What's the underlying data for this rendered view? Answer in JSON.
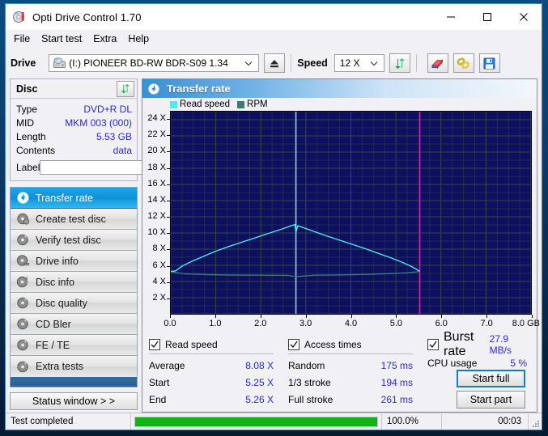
{
  "window": {
    "title": "Opti Drive Control 1.70",
    "icon": "disc-icon",
    "minimize": "minimize-icon",
    "maximize": "maximize-icon",
    "close": "close-icon"
  },
  "menu": {
    "items": [
      {
        "label": "File"
      },
      {
        "label": "Start test"
      },
      {
        "label": "Extra"
      },
      {
        "label": "Help"
      }
    ]
  },
  "drivebar": {
    "drive_label": "Drive",
    "drive_value": "(I:)  PIONEER BD-RW   BDR-S09 1.34",
    "eject_icon": "eject-icon",
    "speed_label": "Speed",
    "speed_value": "12 X",
    "refresh_icon": "refresh-arrows-icon",
    "erase_icon": "eraser-icon",
    "link_icon": "chain-link-icon",
    "save_icon": "floppy-save-icon"
  },
  "disc_panel": {
    "title": "Disc",
    "refresh_icon": "refresh-arrows-icon",
    "rows": [
      {
        "key": "Type",
        "value": "DVD+R DL"
      },
      {
        "key": "MID",
        "value": "MKM 003 (000)"
      },
      {
        "key": "Length",
        "value": "5.53 GB"
      },
      {
        "key": "Contents",
        "value": "data"
      }
    ],
    "label_key": "Label",
    "label_value": "",
    "label_placeholder": "",
    "disc_button_icon": "cd-disc-icon"
  },
  "nav": {
    "items": [
      {
        "label": "Transfer rate",
        "icon": "disc-icon",
        "selected": true
      },
      {
        "label": "Create test disc",
        "icon": "disc-icon",
        "selected": false
      },
      {
        "label": "Verify test disc",
        "icon": "disc-icon",
        "selected": false
      },
      {
        "label": "Drive info",
        "icon": "disc-icon",
        "selected": false
      },
      {
        "label": "Disc info",
        "icon": "disc-icon",
        "selected": false
      },
      {
        "label": "Disc quality",
        "icon": "disc-icon",
        "selected": false
      },
      {
        "label": "CD Bler",
        "icon": "disc-icon",
        "selected": false
      },
      {
        "label": "FE / TE",
        "icon": "disc-icon",
        "selected": false
      },
      {
        "label": "Extra tests",
        "icon": "disc-icon",
        "selected": false
      }
    ],
    "status_window_label": "Status window > >"
  },
  "panel_header": {
    "title": "Transfer rate",
    "icon": "disc-icon"
  },
  "chart_data": {
    "type": "line",
    "title": "Transfer rate",
    "xlabel": "GB",
    "ylabel": "X",
    "xlim": [
      0.0,
      8.0
    ],
    "ylim": [
      0,
      25
    ],
    "xticks": [
      "0.0",
      "1.0",
      "2.0",
      "3.0",
      "4.0",
      "5.0",
      "6.0",
      "7.0",
      "8.0 GB"
    ],
    "xtick_values": [
      0,
      1,
      2,
      3,
      4,
      5,
      6,
      7,
      8
    ],
    "yticks": [
      "2 X",
      "4 X",
      "6 X",
      "8 X",
      "10 X",
      "12 X",
      "14 X",
      "16 X",
      "18 X",
      "20 X",
      "22 X",
      "24 X"
    ],
    "ytick_values": [
      2,
      4,
      6,
      8,
      10,
      12,
      14,
      16,
      18,
      20,
      22,
      24
    ],
    "grid": true,
    "legend_position": "top-left",
    "plot_bg": "#0d1060",
    "grid_color": "#3b4a3b",
    "series": [
      {
        "name": "Read speed",
        "color": "#4fe8f5",
        "x": [
          0.0,
          0.1,
          0.25,
          0.45,
          0.7,
          1.0,
          1.3,
          1.6,
          1.9,
          2.2,
          2.45,
          2.65,
          2.76,
          2.78,
          2.82,
          3.1,
          3.4,
          3.7,
          4.0,
          4.3,
          4.6,
          4.9,
          5.15,
          5.35,
          5.5,
          5.53
        ],
        "values": [
          5.25,
          5.3,
          5.9,
          6.45,
          7.05,
          7.75,
          8.35,
          8.9,
          9.45,
          10.0,
          10.45,
          10.85,
          11.05,
          10.1,
          10.9,
          10.35,
          9.75,
          9.2,
          8.65,
          8.1,
          7.5,
          6.9,
          6.35,
          5.85,
          5.35,
          5.26
        ]
      },
      {
        "name": "RPM",
        "color": "#3c7a74",
        "x": [
          0.0,
          0.3,
          0.8,
          1.4,
          2.0,
          2.6,
          2.78,
          3.2,
          3.8,
          4.4,
          4.9,
          5.25,
          5.45,
          5.53
        ],
        "values": [
          5.2,
          4.95,
          4.85,
          4.8,
          4.78,
          4.76,
          4.6,
          4.78,
          4.82,
          4.88,
          4.98,
          5.08,
          5.18,
          5.26
        ]
      }
    ],
    "markers": [
      {
        "name": "layer-break-marker",
        "x": 2.78,
        "color": "#7fe8ff"
      },
      {
        "name": "disc-end-marker",
        "x": 5.53,
        "color": "#cc22cc"
      }
    ]
  },
  "stats": {
    "read_speed": {
      "checkbox_label": "Read speed",
      "checked": true,
      "rows": [
        {
          "key": "Average",
          "value": "8.08 X"
        },
        {
          "key": "Start",
          "value": "5.25 X"
        },
        {
          "key": "End",
          "value": "5.26 X"
        }
      ]
    },
    "access_times": {
      "checkbox_label": "Access times",
      "checked": true,
      "rows": [
        {
          "key": "Random",
          "value": "175 ms"
        },
        {
          "key": "1/3 stroke",
          "value": "194 ms"
        },
        {
          "key": "Full stroke",
          "value": "261 ms"
        }
      ]
    },
    "burst_rate": {
      "checkbox_label": "Burst rate",
      "checked": true,
      "value": "27.9 MB/s",
      "cpu_key": "CPU usage",
      "cpu_value": "5 %"
    },
    "buttons": {
      "start_full": "Start full",
      "start_part": "Start part"
    }
  },
  "statusbar": {
    "message": "Test completed",
    "progress_percent": "100.0%",
    "progress_value": 100,
    "elapsed": "00:03"
  },
  "colors": {
    "accent": "#0a7fd4",
    "value_text": "#2a2ad0",
    "progress": "#12b312",
    "read_speed": "#4fe8f5",
    "rpm": "#3c7a74"
  }
}
